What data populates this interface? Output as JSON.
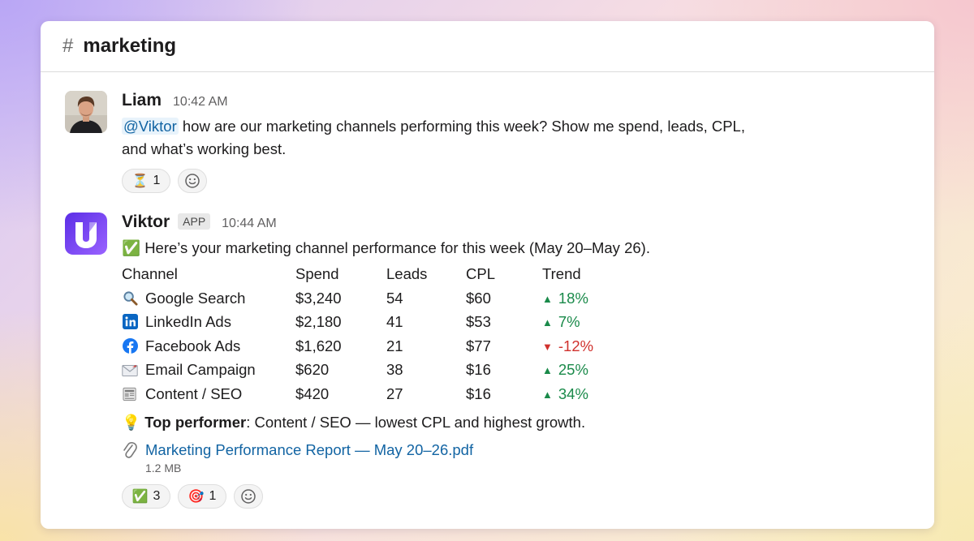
{
  "header": {
    "hash": "#",
    "channel": "marketing"
  },
  "messages": [
    {
      "author": "Liam",
      "time": "10:42 AM",
      "mention": "@Viktor",
      "text_line1": " how are our marketing channels performing this week? Show me spend, leads, CPL,",
      "text_line2": "and what’s working best.",
      "reactions": [
        {
          "emoji": "⏳",
          "count": "1"
        }
      ]
    },
    {
      "author": "Viktor",
      "badge": "APP",
      "time": "10:44 AM",
      "intro_emoji": "✅",
      "intro": "Here’s your marketing channel performance for this week (May 20–May 26).",
      "table": {
        "headers": [
          "Channel",
          "Spend",
          "Leads",
          "CPL",
          "Trend"
        ],
        "rows": [
          {
            "icon": "search-icon",
            "channel": "Google Search",
            "spend": "$3,240",
            "leads": "54",
            "cpl": "$60",
            "trend": "18%",
            "dir": "up"
          },
          {
            "icon": "linkedin-icon",
            "channel": "LinkedIn Ads",
            "spend": "$2,180",
            "leads": "41",
            "cpl": "$53",
            "trend": "7%",
            "dir": "up"
          },
          {
            "icon": "facebook-icon",
            "channel": "Facebook Ads",
            "spend": "$1,620",
            "leads": "21",
            "cpl": "$77",
            "trend": "-12%",
            "dir": "down"
          },
          {
            "icon": "envelope-icon",
            "channel": "Email Campaign",
            "spend": "$620",
            "leads": "38",
            "cpl": "$16",
            "trend": "25%",
            "dir": "up"
          },
          {
            "icon": "newspaper-icon",
            "channel": "Content / SEO",
            "spend": "$420",
            "leads": "27",
            "cpl": "$16",
            "trend": "34%",
            "dir": "up"
          }
        ]
      },
      "tip_emoji": "💡",
      "tip_label": "Top performer",
      "tip_text": ": Content / SEO — lowest CPL and highest growth.",
      "attachment": {
        "name": "Marketing Performance Report — May 20–26.pdf",
        "size": "1.2 MB"
      },
      "reactions": [
        {
          "emoji": "✅",
          "count": "3"
        },
        {
          "emoji": "🎯",
          "count": "1"
        }
      ]
    }
  ],
  "colors": {
    "link": "#1264a3",
    "up": "#1a8a4a",
    "down": "#d0312d",
    "brand": "#6b3df0"
  }
}
